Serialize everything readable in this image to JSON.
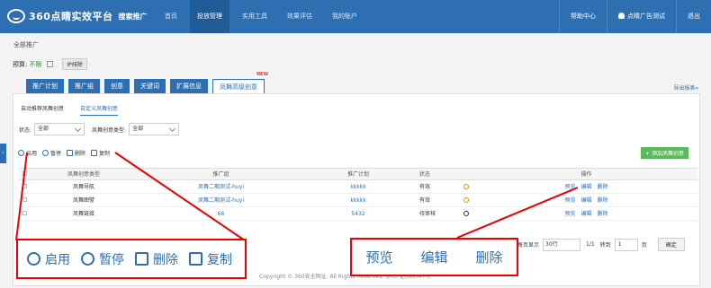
{
  "header": {
    "logo": "360点睛实效平台",
    "logo_sub": "搜索推广",
    "nav": [
      "首页",
      "投放管理",
      "实用工具",
      "效果评估",
      "我的账户"
    ],
    "nav_active": 1,
    "help": "帮助中心",
    "user": "点睛广告测试",
    "logout": "退出"
  },
  "breadcrumb": "全部推广",
  "budget": {
    "label": "预算:",
    "value": "不限",
    "ip_button": "IP排除"
  },
  "tabs": [
    "推广计划",
    "推广组",
    "创意",
    "关键词",
    "扩展信息",
    "凤舞高级创意"
  ],
  "new_badge": "NEW",
  "export": "导出报表»",
  "subtabs": [
    "自动推荐凤舞创意",
    "自定义凤舞创意"
  ],
  "filters": {
    "status_label": "状态:",
    "status_value": "全部",
    "type_label": "凤舞创意类型:",
    "type_value": "全部"
  },
  "actions": [
    "启用",
    "暂停",
    "删除",
    "复制"
  ],
  "add_button": "+ 添加凤舞创意",
  "table": {
    "headers": [
      "凤舞创意类型",
      "推广组",
      "推广计划",
      "状态",
      "操作"
    ],
    "rows": [
      {
        "type": "凤舞导航",
        "group": "凤舞二期测试-huyi",
        "plan": "kkkkk",
        "status": "有效",
        "ops": [
          "预览",
          "编辑",
          "删除"
        ]
      },
      {
        "type": "凤舞图譬",
        "group": "凤舞二期测试-huyi",
        "plan": "kkkkk",
        "status": "有效",
        "ops": [
          "预览",
          "编辑",
          "删除"
        ]
      },
      {
        "type": "凤舞链接",
        "group": "66",
        "plan": "5432",
        "status": "待审核",
        "ops": [
          "预览",
          "编辑",
          "删除"
        ]
      }
    ]
  },
  "pager": {
    "per_page_label": "每页显示",
    "per_page": "30行",
    "page_info": "1/1",
    "goto_label": "转到",
    "page": "1",
    "page_unit": "页",
    "ok": "确定"
  },
  "footer": "Copyright © 360安全网址. All Rights Reserved. 京ICP证080047号",
  "zoom_actions": [
    "启用",
    "暂停",
    "删除",
    "复制"
  ],
  "zoom_ops": [
    "预览",
    "编辑",
    "删除"
  ]
}
